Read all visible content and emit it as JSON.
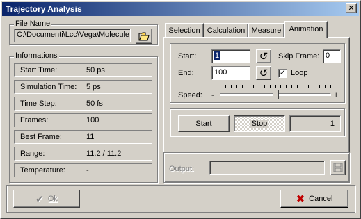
{
  "window": {
    "title": "Trajectory Analysis"
  },
  "file_name": {
    "legend": "File Name",
    "path": "C:\\Documenti\\Lcc\\Vega\\Molecule"
  },
  "informations": {
    "legend": "Informations",
    "rows": [
      {
        "label": "Start Time:",
        "value": "50 ps"
      },
      {
        "label": "Simulation Time:",
        "value": "5 ps"
      },
      {
        "label": "Time Step:",
        "value": "50 fs"
      },
      {
        "label": "Frames:",
        "value": "100"
      },
      {
        "label": "Best Frame:",
        "value": "11"
      },
      {
        "label": "Range:",
        "value": "11.2 / 11.2"
      },
      {
        "label": "Temperature:",
        "value": "-"
      }
    ]
  },
  "tabs": [
    "Selection",
    "Calculation",
    "Measure",
    "Animation"
  ],
  "active_tab": "Animation",
  "animation": {
    "start_label": "Start:",
    "start_value": "1",
    "end_label": "End:",
    "end_value": "100",
    "skip_label": "Skip Frame:",
    "skip_value": "0",
    "loop_label": "Loop",
    "loop_checked": true,
    "speed_label": "Speed:",
    "speed_minus": "-",
    "speed_plus": "+",
    "speed_level": 0.5,
    "start_button": "Start",
    "stop_button": "Stop",
    "frame_counter": "1"
  },
  "output": {
    "label": "Output:",
    "value": ""
  },
  "footer": {
    "ok_label": "Ok",
    "cancel_label": "Cancel"
  },
  "colors": {
    "titlebar_start": "#0a246a",
    "titlebar_end": "#a6caf0",
    "face": "#d4d0c8",
    "cancel_x": "#c00000"
  }
}
